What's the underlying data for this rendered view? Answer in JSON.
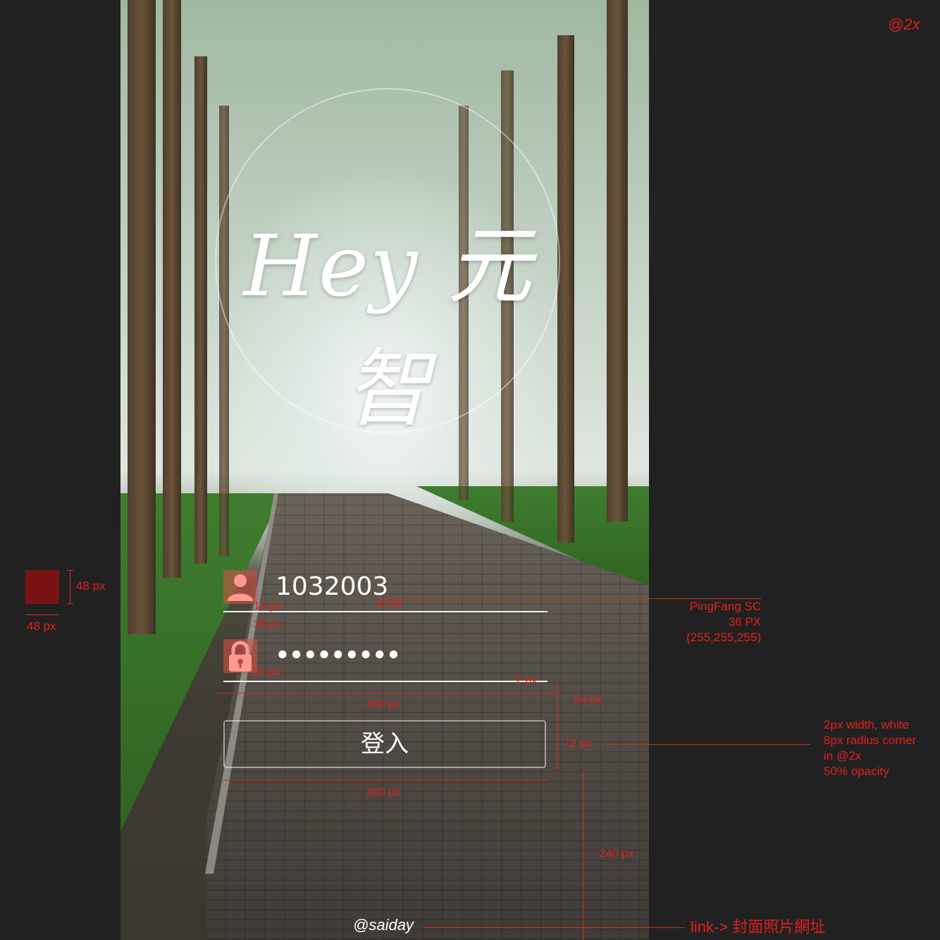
{
  "scale_label": "@2x",
  "logo": {
    "text": "Hey 元智"
  },
  "login": {
    "username_value": "1032003",
    "password_mask": "●●●●●●●●●",
    "button_label": "登入"
  },
  "credit": "@saiday",
  "annotations": {
    "icon_height": "48 px",
    "icon_width": "48 px",
    "gap_icon_text": "10 px",
    "gap_text_line": "20 px",
    "gap_between_rows": "36 px",
    "gap_icon_line": "30 px",
    "line_thickness": "2 px",
    "field_width": "480 px",
    "gap_to_button": "54 px",
    "button_height": "72 px",
    "button_width": "460 px",
    "bottom_gap": "240 px",
    "font_spec": [
      "PingFang SC",
      "36 PX",
      "(255,255,255)"
    ],
    "button_spec": [
      "2px width, white",
      "8px radius corner",
      "in @2x",
      "50% opacity"
    ],
    "link_note": "link-> 封面照片網址"
  },
  "colors": {
    "annotation_red": "#e0201c",
    "icon_fill": "#dc5046",
    "swatch": "#7a1414"
  }
}
